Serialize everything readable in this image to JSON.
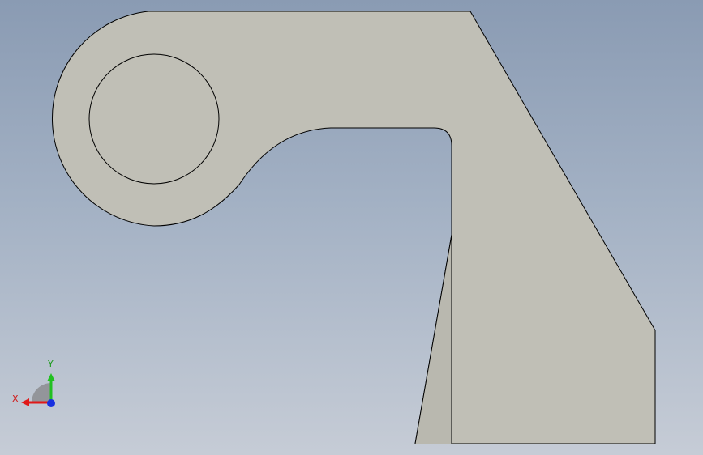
{
  "viewport": {
    "background_top": "#8a9bb3",
    "background_bottom": "#c6ccd6"
  },
  "model": {
    "face_color": "#c0bfb6",
    "edge_color": "#000000",
    "features": [
      "outer-profile",
      "bore-hole",
      "tapered-face-edge"
    ]
  },
  "triad": {
    "x_label": "X",
    "y_label": "Y",
    "x_color": "#e01818",
    "y_color": "#22c022",
    "z_color": "#1830e0",
    "icons": [
      "x-axis-arrow-icon",
      "y-axis-arrow-icon",
      "z-axis-dot-icon"
    ]
  }
}
